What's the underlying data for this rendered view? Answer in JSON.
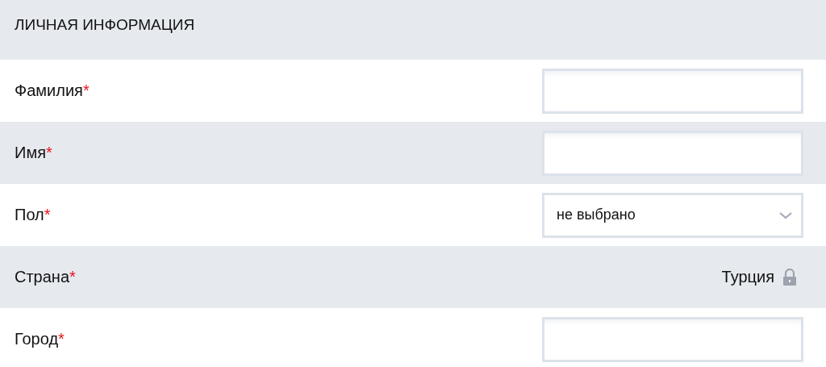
{
  "section": {
    "title": "ЛИЧНАЯ ИНФОРМАЦИЯ"
  },
  "fields": [
    {
      "kind": "text",
      "label": "Фамилия",
      "required_mark": "*"
    },
    {
      "kind": "text",
      "label": "Имя",
      "required_mark": "*"
    },
    {
      "kind": "select",
      "label": "Пол",
      "required_mark": "*",
      "value": "не выбрано"
    },
    {
      "kind": "locked",
      "label": "Страна",
      "required_mark": "*",
      "value": "Турция"
    },
    {
      "kind": "text",
      "label": "Город",
      "required_mark": "*"
    }
  ]
}
